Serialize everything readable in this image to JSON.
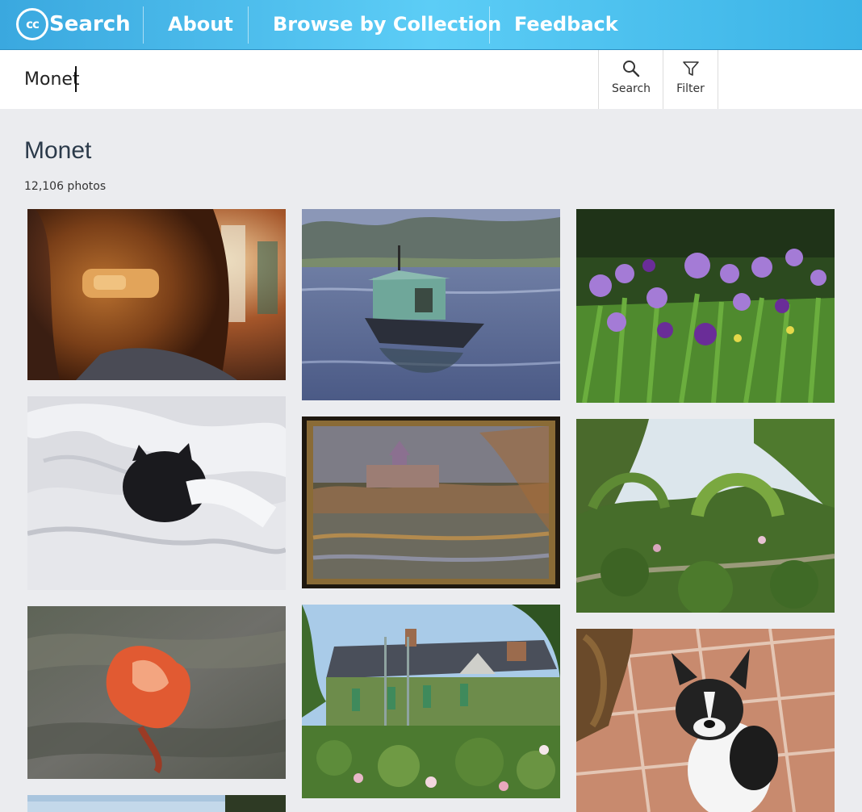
{
  "header": {
    "logo_mark": "cc",
    "logo_text": "Search",
    "nav": [
      "About",
      "Browse by Collection",
      "Feedback"
    ]
  },
  "search": {
    "query": "Monet",
    "search_label": "Search",
    "filter_label": "Filter"
  },
  "results": {
    "title": "Monet",
    "count": "12,106 photos"
  },
  "colors": {
    "header_start": "#3aa8df",
    "header_end": "#5ccdf6",
    "background": "#ebecef"
  }
}
